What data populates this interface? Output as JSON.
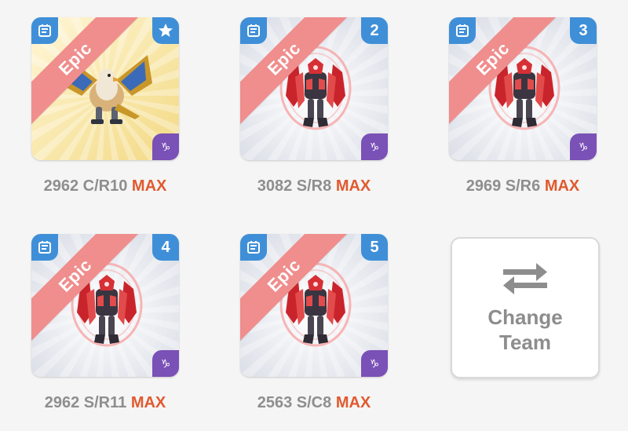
{
  "team": {
    "slots": [
      {
        "rarity": "Epic",
        "badge": "star",
        "stats": "2962 C/R10",
        "status": "MAX",
        "art": "griffin"
      },
      {
        "rarity": "Epic",
        "badge": "2",
        "stats": "3082 S/R8",
        "status": "MAX",
        "art": "robot"
      },
      {
        "rarity": "Epic",
        "badge": "3",
        "stats": "2969 S/R6",
        "status": "MAX",
        "art": "robot"
      },
      {
        "rarity": "Epic",
        "badge": "4",
        "stats": "2962 S/R11",
        "status": "MAX",
        "art": "robot"
      },
      {
        "rarity": "Epic",
        "badge": "5",
        "stats": "2563 S/C8",
        "status": "MAX",
        "art": "robot"
      }
    ],
    "change_team": {
      "line1": "Change",
      "line2": "Team",
      "icon": "swap-arrows-icon"
    }
  },
  "colors": {
    "epic_ribbon": "#f08d8d",
    "badge_blue": "#3f8fd8",
    "element_purple": "#7a51b6",
    "max_orange": "#e05a2f",
    "label_gray": "#8e8e8e"
  }
}
